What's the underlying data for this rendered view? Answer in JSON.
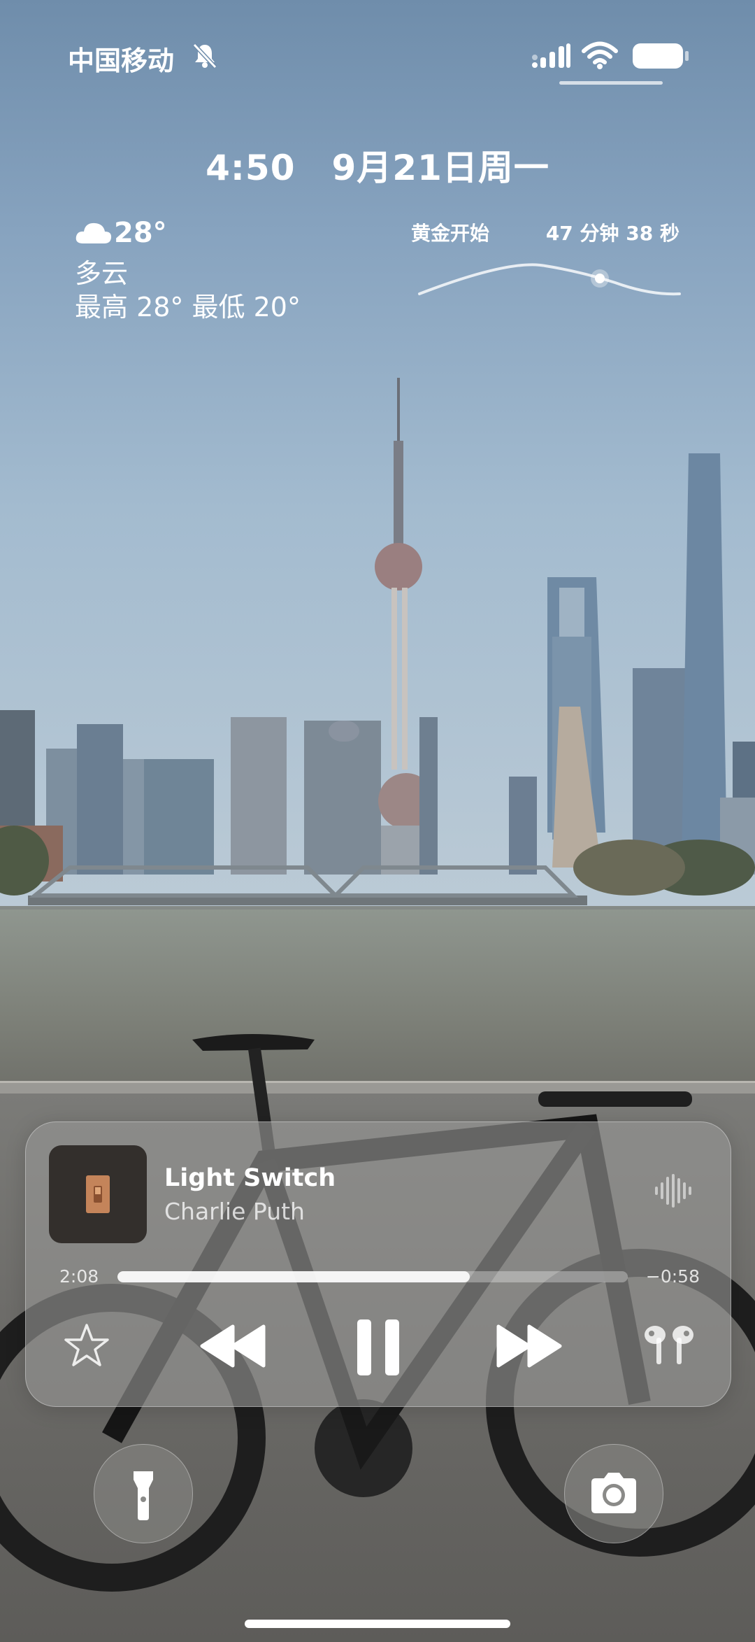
{
  "status_bar": {
    "carrier": "中国移动",
    "silent_icon": "bell-slash-icon",
    "signal_icon": "cellular-signal-icon",
    "wifi_icon": "wifi-icon",
    "battery_icon": "battery-icon"
  },
  "lock_screen": {
    "time": "4:50",
    "date": "9月21日周一"
  },
  "weather": {
    "icon": "cloud-icon",
    "temperature": "28°",
    "condition": "多云",
    "range": "最高 28° 最低 20°"
  },
  "sun_widget": {
    "label": "黄金开始",
    "remaining": "47 分钟 38 秒"
  },
  "now_playing": {
    "title": "Light Switch",
    "artist": "Charlie Puth",
    "elapsed": "2:08",
    "remaining": "−0:58",
    "progress": 0.69,
    "artwork_icon": "light-switch-artwork",
    "controls": [
      "star-icon",
      "rewind-icon",
      "pause-icon",
      "fast-forward-icon",
      "airpods-icon"
    ]
  },
  "quick_actions": [
    "flashlight-icon",
    "camera-icon"
  ],
  "colors": {
    "sky_top": "#6f8dab",
    "sky_bottom": "#bccbd6",
    "card_tint": "#969694",
    "text": "#ffffff"
  }
}
